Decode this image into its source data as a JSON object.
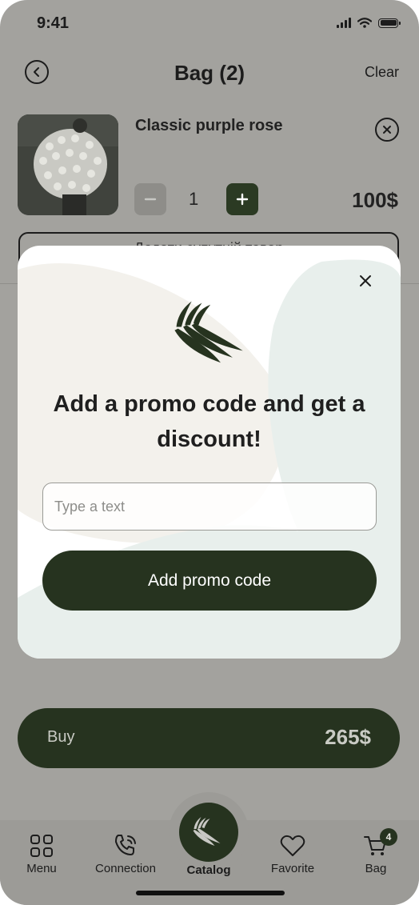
{
  "status_bar": {
    "time": "9:41"
  },
  "header": {
    "title": "Bag (2)",
    "clear_label": "Clear"
  },
  "cart": {
    "items": [
      {
        "name": "Classic purple rose",
        "quantity": "1",
        "price": "100$"
      }
    ],
    "obscured_button_label": "Додати супутній товар"
  },
  "promo_modal": {
    "title": "Add a promo code and get a discount!",
    "input_placeholder": "Type a text",
    "input_value": "",
    "submit_label": "Add promo code"
  },
  "buy": {
    "label": "Buy",
    "total": "265$"
  },
  "tabbar": {
    "items": [
      {
        "label": "Menu",
        "icon": "grid-icon"
      },
      {
        "label": "Connection",
        "icon": "phone-icon"
      },
      {
        "label": "Catalog",
        "icon": "leaf-logo-icon",
        "active": true
      },
      {
        "label": "Favorite",
        "icon": "heart-icon"
      },
      {
        "label": "Bag",
        "icon": "cart-icon",
        "badge": "4"
      }
    ]
  },
  "colors": {
    "accent": "#26331f",
    "overlay": "#a3a29e",
    "modal_blob_left": "#f3f1ec",
    "modal_blob_right": "#e8efec"
  }
}
